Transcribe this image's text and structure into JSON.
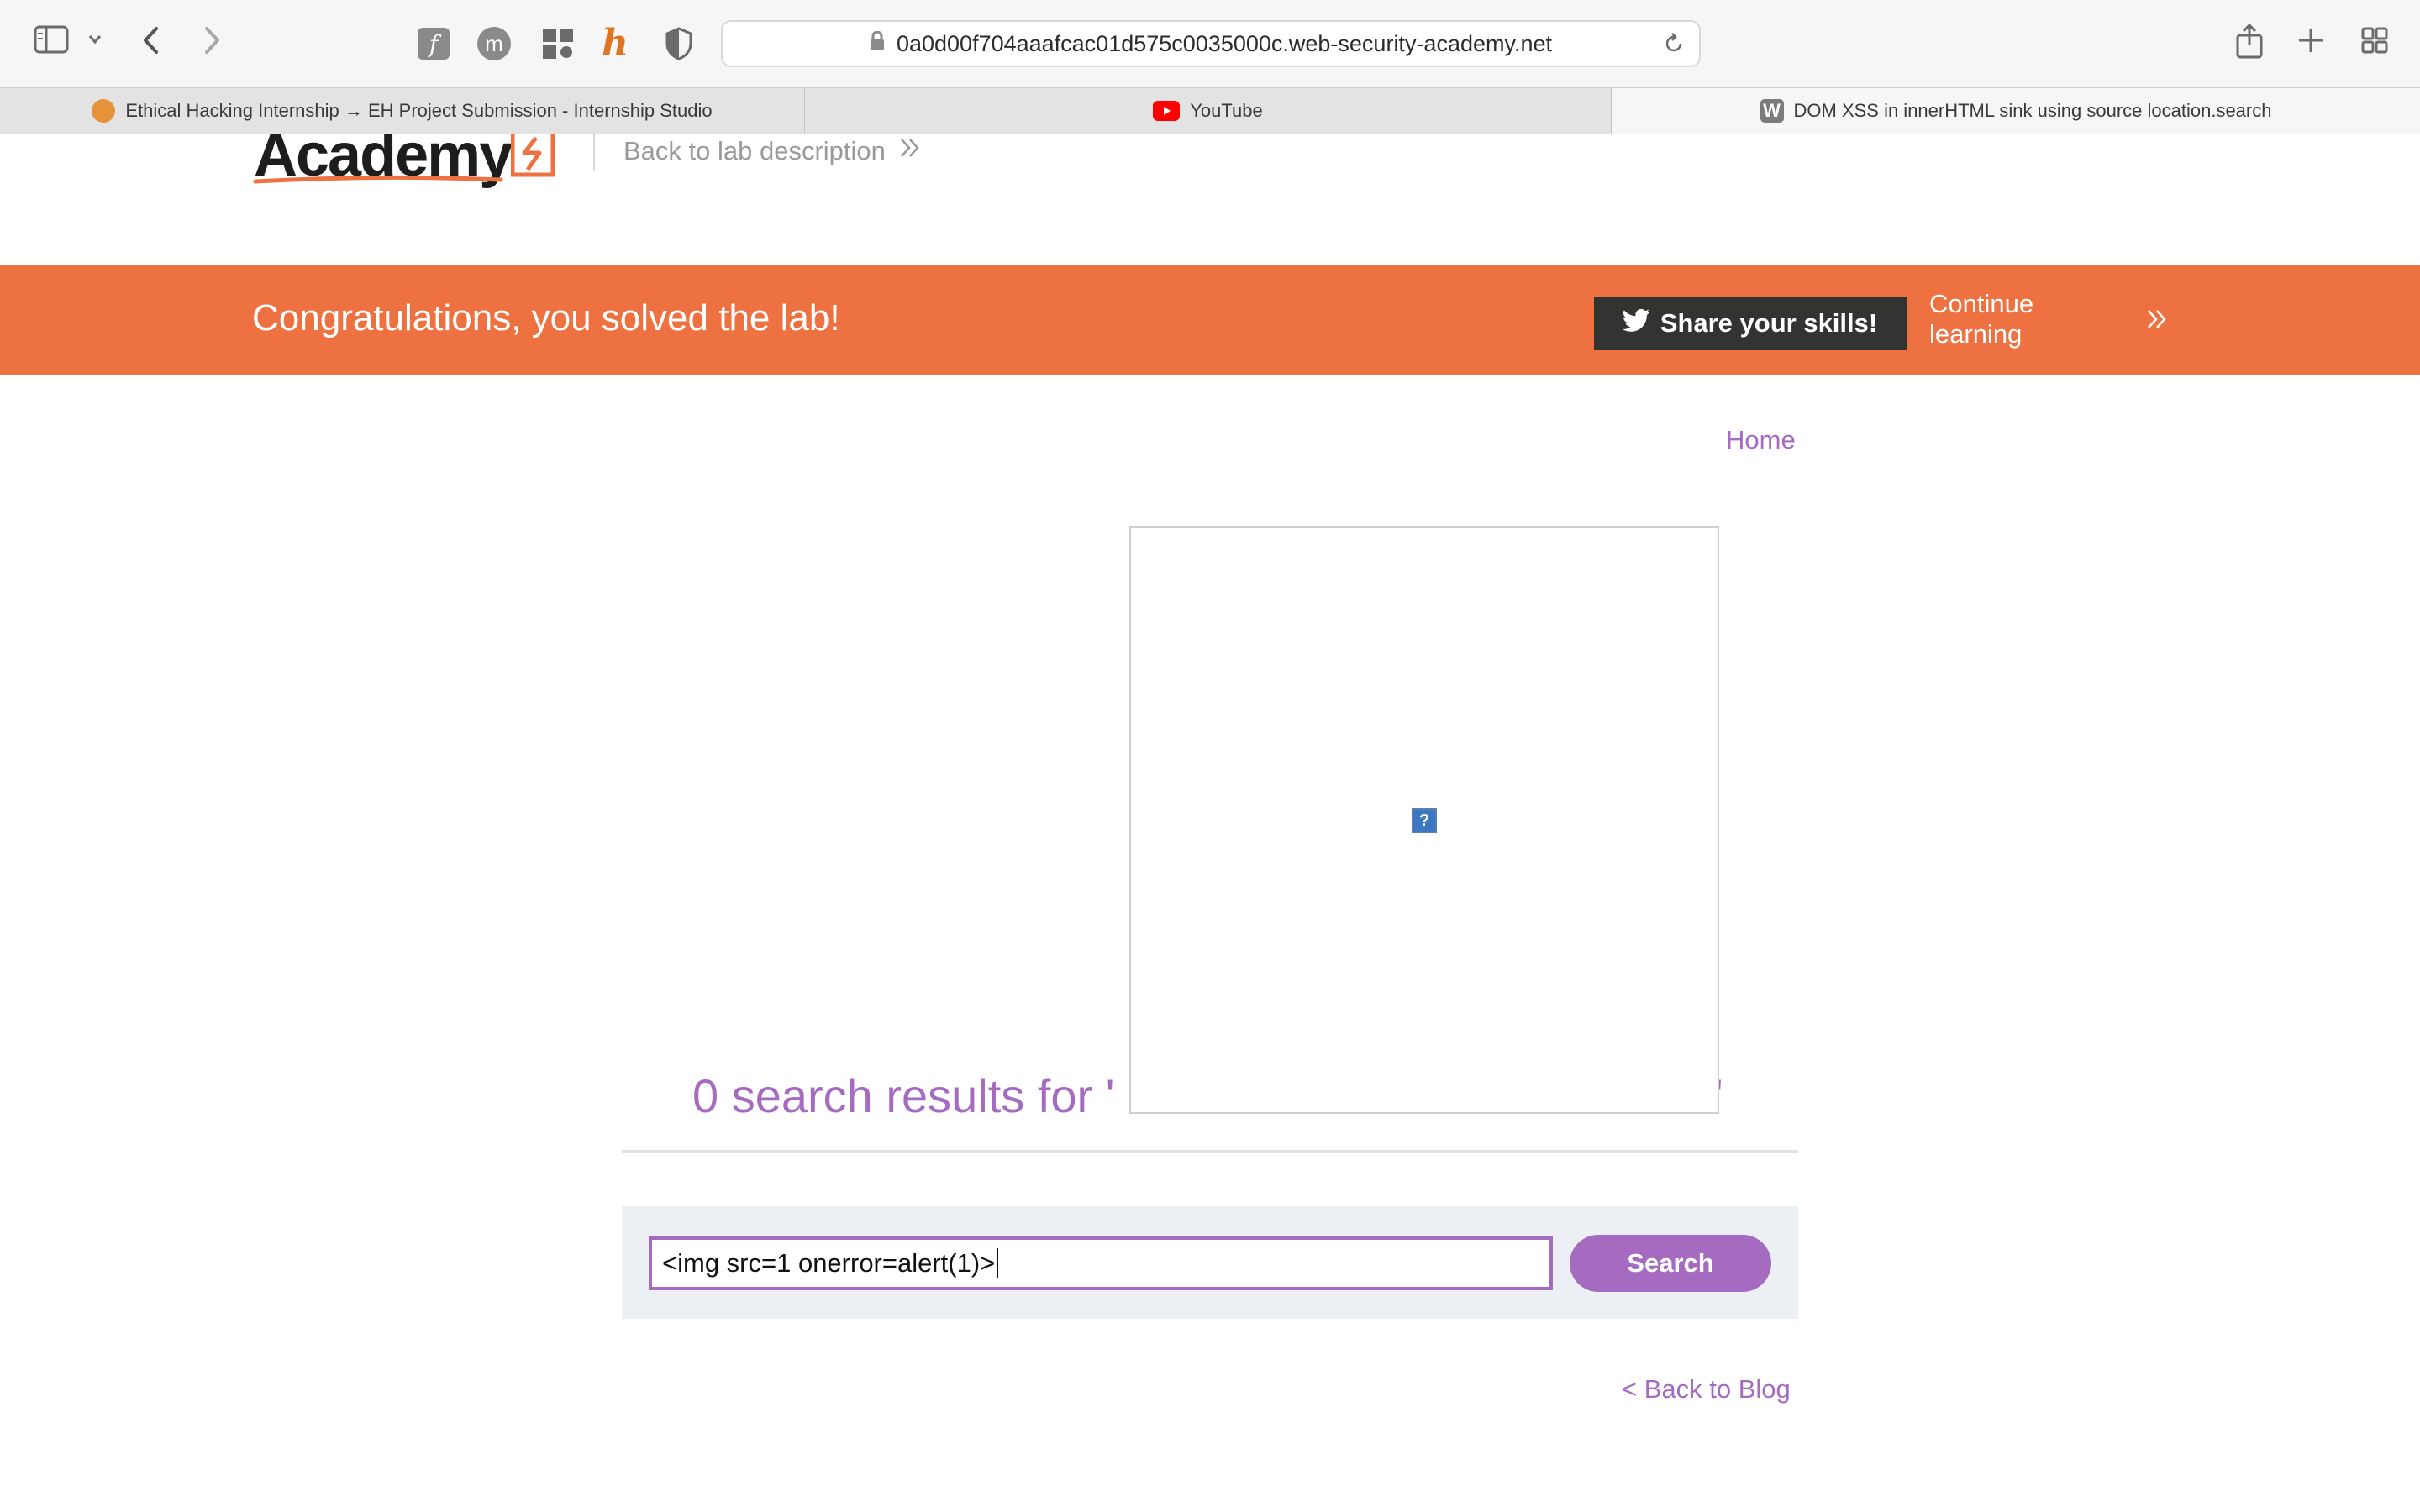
{
  "browser": {
    "url": "0a0d00f704aaafcac01d575c0035000c.web-security-academy.net",
    "tabs": [
      {
        "title": "Ethical Hacking Internship → EH Project Submission - Internship Studio",
        "favicon_color": "#e8913b"
      },
      {
        "title": "YouTube",
        "favicon_color": "#ff0000"
      },
      {
        "title": "DOM XSS in innerHTML sink using source location.search",
        "favicon_color": "#7b7b7b",
        "favicon_letter": "W"
      }
    ],
    "extension_letters": {
      "m": "m",
      "h": "h"
    }
  },
  "header": {
    "logo_text": "Academy",
    "back_link": "Back to lab description"
  },
  "banner": {
    "message": "Congratulations, you solved the lab!",
    "share_label": "Share your skills!",
    "continue_label": "Continue learning",
    "color": "#ee7241"
  },
  "nav": {
    "home_label": "Home"
  },
  "results": {
    "heading": "0 search results for '",
    "closing_quote": "'",
    "broken_image_glyph": "?"
  },
  "search": {
    "value": "<img src=1 onerror=alert(1)>",
    "button_label": "Search"
  },
  "footer": {
    "back_blog": "< Back to Blog"
  },
  "colors": {
    "accent": "#a46bc0",
    "banner": "#ee7241"
  }
}
